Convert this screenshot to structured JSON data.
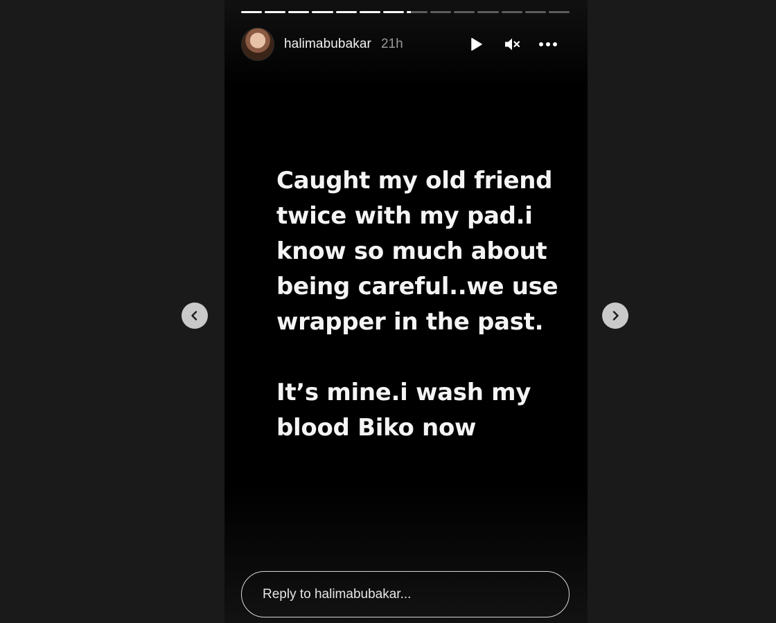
{
  "story": {
    "username": "halimabubakar",
    "time_ago": "21h",
    "progress": {
      "segments_total": 14,
      "segments_completed": 7,
      "current_fraction": 0.2
    },
    "text": [
      "Caught my old friend\ntwice with my pad.i\nknow so much about\nbeing careful..we use\nwrapper in the past.",
      "It’s mine.i wash my\nblood Biko now"
    ],
    "controls": {
      "play_icon": "play-icon",
      "mute_icon": "speaker-muted-icon",
      "more_icon": "more-horizontal-icon"
    }
  },
  "navigation": {
    "prev_icon": "chevron-left-icon",
    "next_icon": "chevron-right-icon"
  },
  "reply": {
    "placeholder": "Reply to halimabubakar..."
  },
  "colors": {
    "page_background": "#1a1a1a",
    "story_background": "#000000",
    "text": "#f4f4f4",
    "muted_text": "#9a9a9a",
    "nav_button": "#c9c9c9"
  }
}
